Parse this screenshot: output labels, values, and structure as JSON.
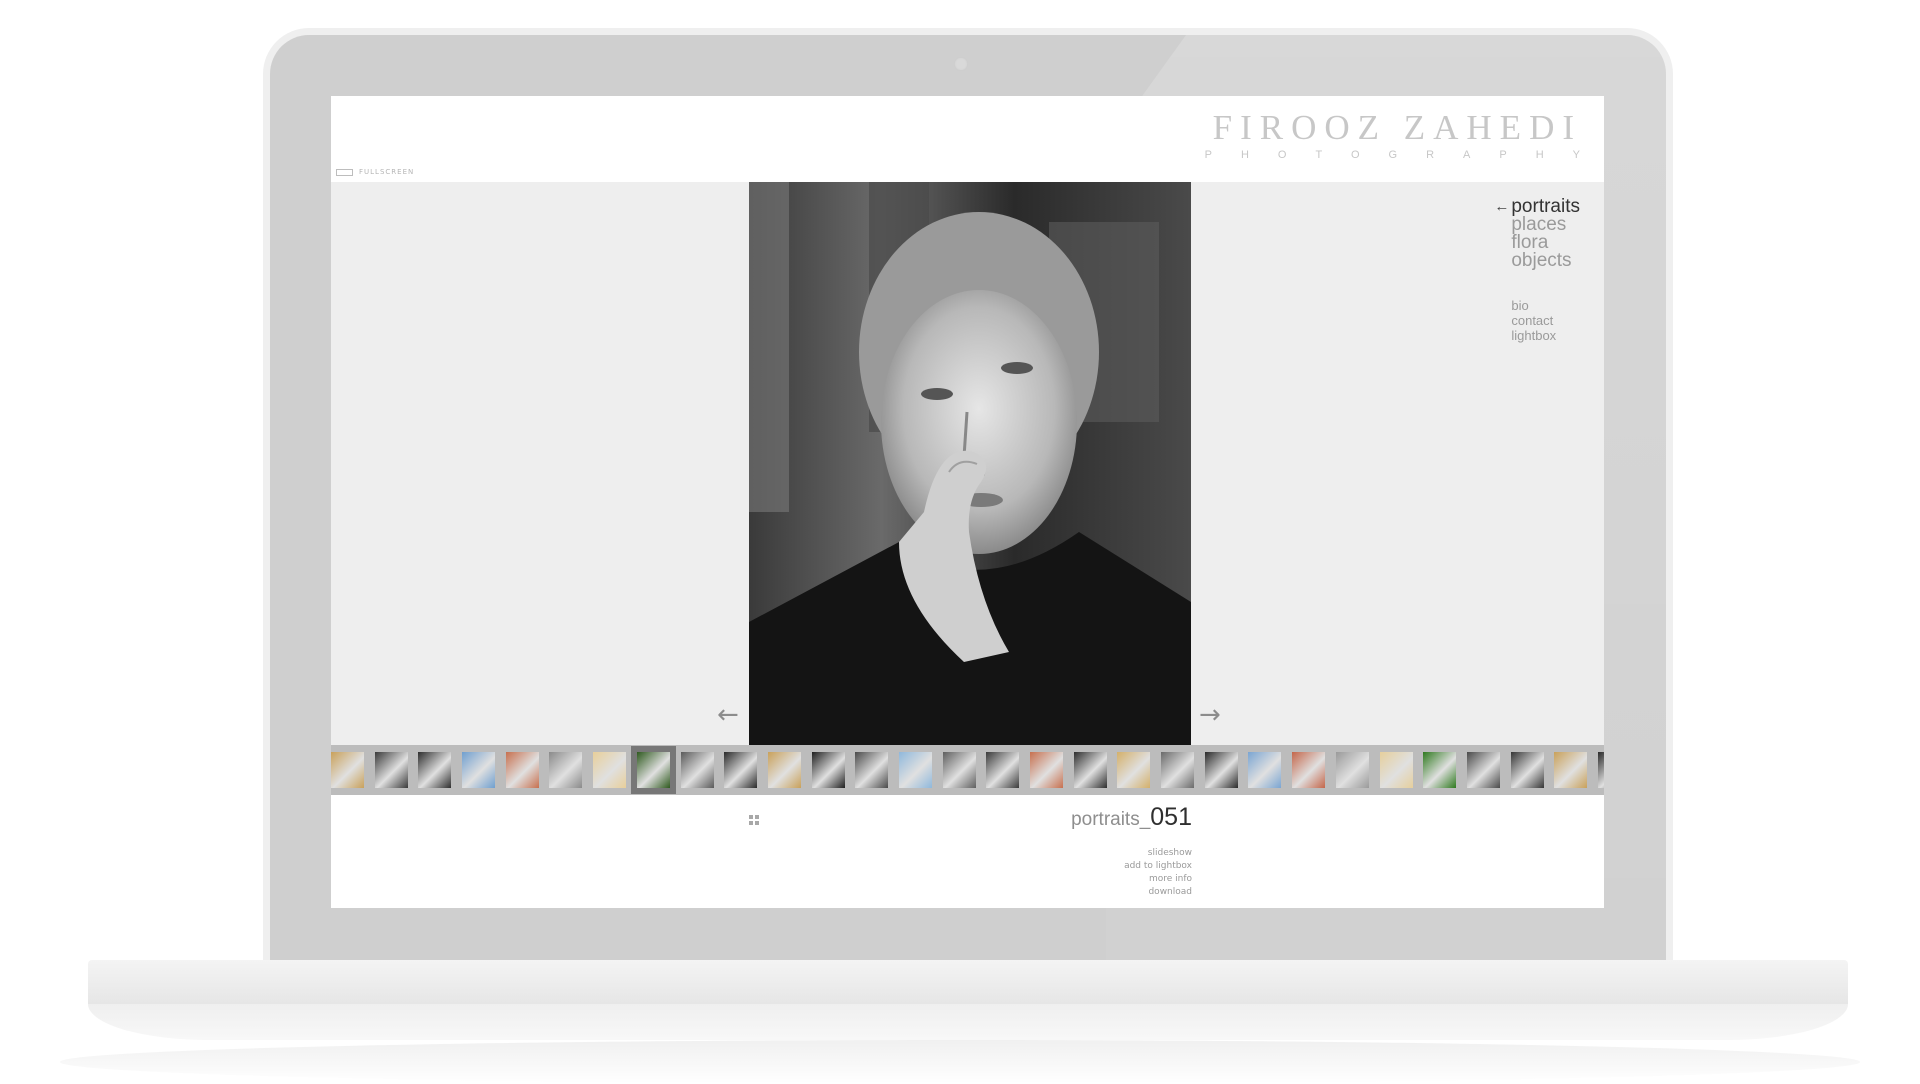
{
  "brand": {
    "name": "FIROOZ ZAHEDI",
    "subtitle": "PHOTOGRAPHY"
  },
  "toolbar": {
    "fullscreen_label": "FULLSCREEN"
  },
  "icons": {
    "fullscreen": "fullscreen-icon",
    "grid": "grid-icon",
    "prev": "arrow-left-icon",
    "next": "arrow-right-icon"
  },
  "nav": {
    "active_arrow": "←",
    "primary": [
      {
        "label": "portraits",
        "active": true
      },
      {
        "label": "places",
        "active": false
      },
      {
        "label": "flora",
        "active": false
      },
      {
        "label": "objects",
        "active": false
      }
    ],
    "secondary": [
      {
        "label": "bio"
      },
      {
        "label": "contact"
      },
      {
        "label": "lightbox"
      }
    ]
  },
  "viewer": {
    "prev_arrow": "←",
    "next_arrow": "→"
  },
  "filmstrip": {
    "selected_index": 7,
    "thumbs": [
      "#c9a15a",
      "#3a3a3a",
      "#2e2e2e",
      "#6f9fcf",
      "#c7704f",
      "#8a8a8a",
      "#e8cf9a",
      "#2f5a1f",
      "#5a5a5a",
      "#2a2a2a",
      "#c9a15a",
      "#1f1f1f",
      "#4a4a4a",
      "#8fb8dc",
      "#5f5f5f",
      "#3a3a3a",
      "#c7704f",
      "#2e2e2e",
      "#d4b06a",
      "#6a6a6a",
      "#2a2a2a",
      "#7aa5d2",
      "#c4664a",
      "#9a9a9a",
      "#e6cf9c",
      "#2f7a1f",
      "#4a4a4a",
      "#353535",
      "#c9a15a",
      "#2a2a2a"
    ]
  },
  "caption": {
    "category": "portraits_",
    "number": "051"
  },
  "actions": [
    {
      "label": "slideshow"
    },
    {
      "label": "add to lightbox"
    },
    {
      "label": "more info"
    },
    {
      "label": "download"
    }
  ],
  "colors": {
    "gallery_bg": "#eeeeee",
    "filmstrip_bg": "#bcbcbc",
    "nav_active": "#333333",
    "nav_inactive": "#9a9a9a"
  }
}
